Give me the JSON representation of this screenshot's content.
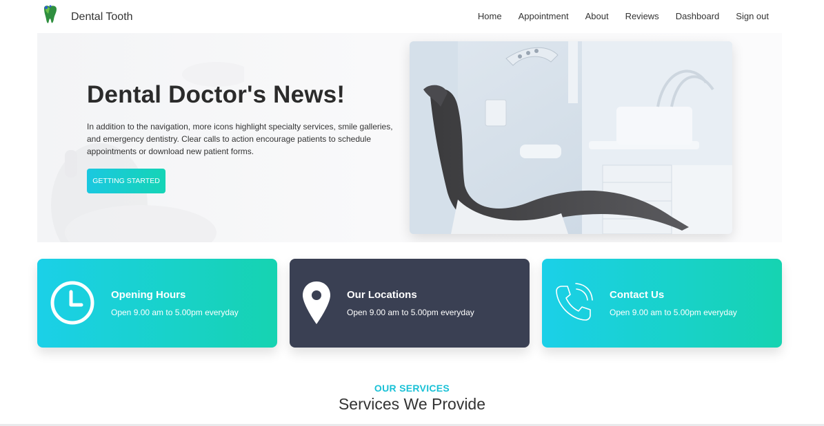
{
  "brand": {
    "name": "Dental Tooth",
    "logo_icon": "tooth-icon"
  },
  "nav": {
    "items": [
      {
        "label": "Home"
      },
      {
        "label": "Appointment"
      },
      {
        "label": "About"
      },
      {
        "label": "Reviews"
      },
      {
        "label": "Dashboard"
      },
      {
        "label": "Sign out"
      }
    ]
  },
  "hero": {
    "title": "Dental Doctor's News!",
    "text": "In addition to the navigation, more icons highlight specialty services, smile galleries, and emergency dentistry. Clear calls to action encourage patients to schedule appointments or download new patient forms.",
    "cta_label": "GETTING STARTED",
    "image_icon": "dental-chair-image"
  },
  "cards": [
    {
      "title": "Opening Hours",
      "text": "Open 9.00 am to 5.00pm everyday",
      "icon": "clock-icon"
    },
    {
      "title": "Our Locations",
      "text": "Open 9.00 am to 5.00pm everyday",
      "icon": "location-pin-icon"
    },
    {
      "title": "Contact Us",
      "text": "Open 9.00 am to 5.00pm everyday",
      "icon": "phone-icon"
    }
  ],
  "services": {
    "eyebrow": "OUR SERVICES",
    "heading": "Services We Provide"
  },
  "colors": {
    "accent_cyan": "#1bd0e8",
    "accent_teal": "#16d3b1",
    "card_dark": "#3a4053",
    "services_eyebrow": "#19c1d6"
  }
}
